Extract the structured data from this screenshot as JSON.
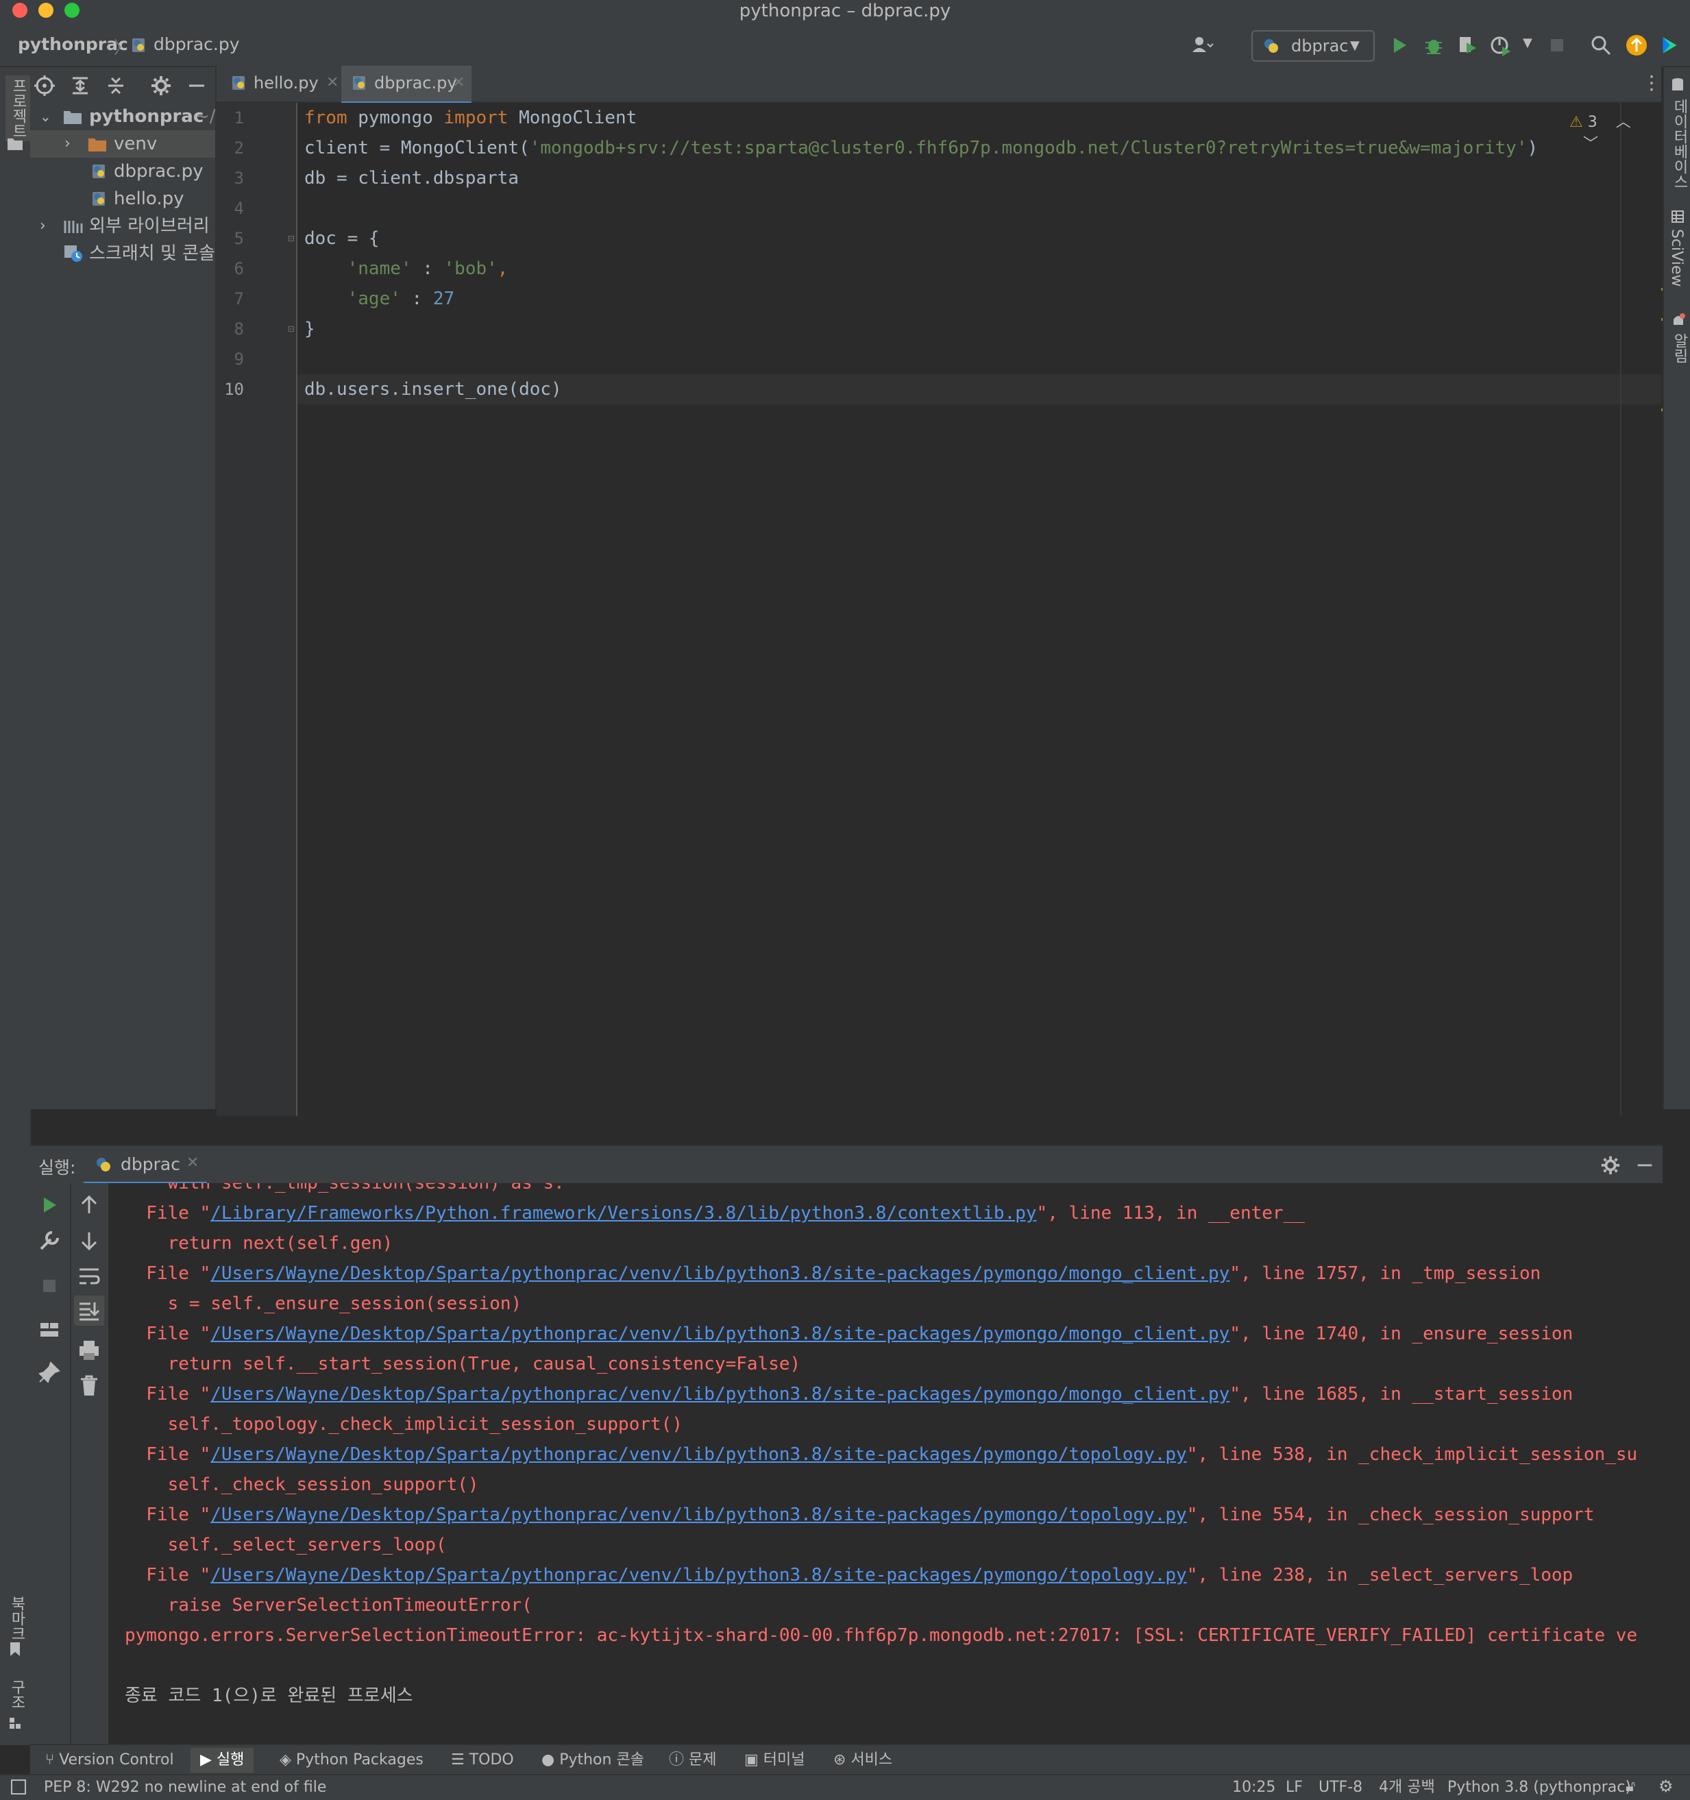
{
  "window": {
    "title": "pythonprac – dbprac.py"
  },
  "navbar": {
    "project_name": "pythonprac",
    "file_name": "dbprac.py",
    "run_config": "dbprac"
  },
  "left_strip": {
    "project_tab": "프로젝트",
    "bookmarks_tab": "북마크",
    "structure_tab": "구조"
  },
  "right_strip": {
    "database_tab": "데이터베이스",
    "sciview_tab": "SciView",
    "notifications_tab": "알림"
  },
  "project_tree": {
    "root_label": "pythonprac",
    "root_path": "~/l",
    "items": [
      {
        "label": "venv"
      },
      {
        "label": "dbprac.py"
      },
      {
        "label": "hello.py"
      },
      {
        "label": "외부 라이브러리"
      },
      {
        "label": "스크래치 및 콘솔"
      }
    ]
  },
  "editor": {
    "tabs": [
      {
        "label": "hello.py"
      },
      {
        "label": "dbprac.py"
      }
    ],
    "warning_count": "3",
    "line_numbers": [
      "1",
      "2",
      "3",
      "4",
      "5",
      "6",
      "7",
      "8",
      "9",
      "10"
    ],
    "lines": {
      "l1_kw1": "from",
      "l1_mod": " pymongo ",
      "l1_kw2": "import",
      "l1_name": " MongoClient",
      "l2_pre": "client = MongoClient(",
      "l2_str": "'mongodb+srv://test:sparta@cluster0.fhf6p7p.mongodb.net/Cluster0?retryWrites=true&w=majority'",
      "l2_post": ")",
      "l3": "db = client.dbsparta",
      "l5": "doc = {",
      "l6_key": "'name'",
      "l6_mid": " : ",
      "l6_val": "'bob'",
      "l6_end": ",",
      "l7_key": "'age'",
      "l7_mid": " : ",
      "l7_val": "27",
      "l8": "}",
      "l10": "db.users.insert_one(doc)"
    }
  },
  "run_panel": {
    "label": "실행:",
    "tab_name": "dbprac",
    "console": {
      "top_partial": "    with self._tmp_session(session) as s:",
      "frames": [
        {
          "prefix": "  File \"",
          "path": "/Library/Frameworks/Python.framework/Versions/3.8/lib/python3.8/contextlib.py",
          "suffix": "\", line 113, in __enter__",
          "code": "    return next(self.gen)"
        },
        {
          "prefix": "  File \"",
          "path": "/Users/Wayne/Desktop/Sparta/pythonprac/venv/lib/python3.8/site-packages/pymongo/mongo_client.py",
          "suffix": "\", line 1757, in _tmp_session",
          "code": "    s = self._ensure_session(session)"
        },
        {
          "prefix": "  File \"",
          "path": "/Users/Wayne/Desktop/Sparta/pythonprac/venv/lib/python3.8/site-packages/pymongo/mongo_client.py",
          "suffix": "\", line 1740, in _ensure_session",
          "code": "    return self.__start_session(True, causal_consistency=False)"
        },
        {
          "prefix": "  File \"",
          "path": "/Users/Wayne/Desktop/Sparta/pythonprac/venv/lib/python3.8/site-packages/pymongo/mongo_client.py",
          "suffix": "\", line 1685, in __start_session",
          "code": "    self._topology._check_implicit_session_support()"
        },
        {
          "prefix": "  File \"",
          "path": "/Users/Wayne/Desktop/Sparta/pythonprac/venv/lib/python3.8/site-packages/pymongo/topology.py",
          "suffix": "\", line 538, in _check_implicit_session_su",
          "code": "    self._check_session_support()"
        },
        {
          "prefix": "  File \"",
          "path": "/Users/Wayne/Desktop/Sparta/pythonprac/venv/lib/python3.8/site-packages/pymongo/topology.py",
          "suffix": "\", line 554, in _check_session_support",
          "code": "    self._select_servers_loop("
        },
        {
          "prefix": "  File \"",
          "path": "/Users/Wayne/Desktop/Sparta/pythonprac/venv/lib/python3.8/site-packages/pymongo/topology.py",
          "suffix": "\", line 238, in _select_servers_loop",
          "code": "    raise ServerSelectionTimeoutError("
        }
      ],
      "error_line": "pymongo.errors.ServerSelectionTimeoutError: ac-kytijtx-shard-00-00.fhf6p7p.mongodb.net:27017: [SSL: CERTIFICATE_VERIFY_FAILED] certificate ve",
      "exit_message": "종료 코드 1(으)로 완료된 프로세스"
    }
  },
  "bottom_toolbar": {
    "version_control": "Version Control",
    "run": "실행",
    "python_packages": "Python Packages",
    "todo": "TODO",
    "python_console": "Python 콘솔",
    "problems": "문제",
    "terminal": "터미널",
    "services": "서비스"
  },
  "status_bar": {
    "message": "PEP 8: W292 no newline at end of file",
    "position": "10:25",
    "line_separator": "LF",
    "encoding": "UTF-8",
    "indent": "4개 공백",
    "interpreter": "Python 3.8 (pythonprac)"
  },
  "colors": {
    "keyword": "#cc7832",
    "string": "#6a8759",
    "number": "#6897bb",
    "error_text": "#ff6b68",
    "link": "#5394ec",
    "run_green": "#499c54"
  }
}
